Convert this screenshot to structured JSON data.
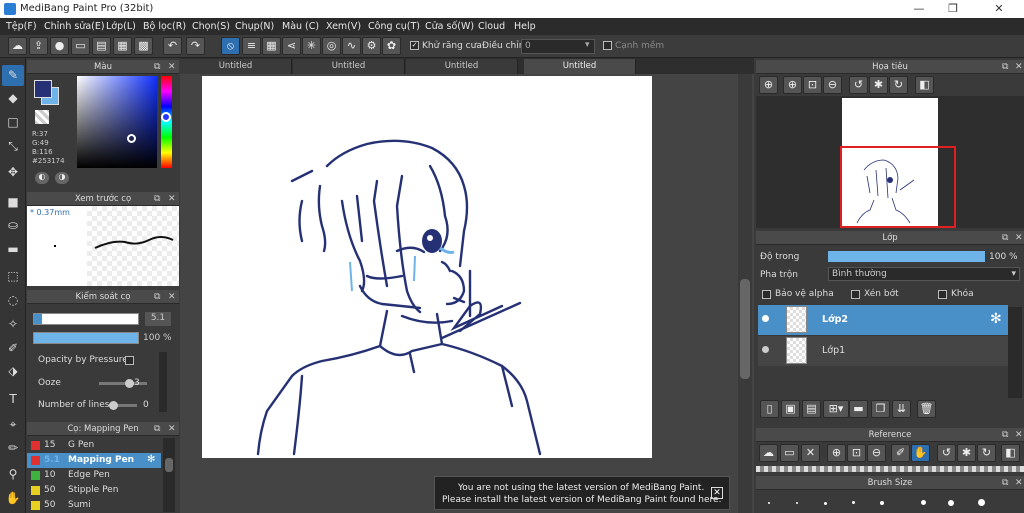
{
  "window": {
    "title": "MediBang Paint Pro (32bit)",
    "minimize": "—",
    "restore": "❐",
    "close": "✕"
  },
  "menu": [
    "Tệp(F)",
    "Chỉnh sửa(E)",
    "Lớp(L)",
    "Bộ lọc(R)",
    "Chọn(S)",
    "Chụp(N)",
    "Màu (C)",
    "Xem(V)",
    "Công cụ(T)",
    "Cửa số(W)",
    "Cloud",
    "Help"
  ],
  "toolbar": {
    "antialias_label": "Khử răng cưa",
    "adjust_label": "Điều chỉnh",
    "zoom_value": "0",
    "edge_label": "Cạnh mềm"
  },
  "color_panel": {
    "title": "Màu",
    "r": "R:37",
    "g": "G:49",
    "b": "B:116",
    "hex": "#253174",
    "main_color": "#253174",
    "secondary_color": "#6fb4e8"
  },
  "brush_preview": {
    "title": "Xem trước cọ",
    "size": "0.37mm"
  },
  "brush_control": {
    "title": "Kiểm soát cọ",
    "size_value": "5.1",
    "opacity_value": "100 %",
    "opacity_pressure_label": "Opacity by Pressure",
    "ooze_label": "Ooze",
    "ooze_value": "3",
    "lines_label": "Number of lines",
    "lines_value": "0"
  },
  "brush_list": {
    "title": "Cọ: Mapping Pen",
    "items": [
      {
        "size": "15",
        "name": "G Pen",
        "color": "#e03030"
      },
      {
        "size": "5.1",
        "name": "Mapping Pen",
        "color": "#e03030"
      },
      {
        "size": "10",
        "name": "Edge Pen",
        "color": "#40b040"
      },
      {
        "size": "50",
        "name": "Stipple Pen",
        "color": "#e8d020"
      },
      {
        "size": "50",
        "name": "Sumi",
        "color": "#e8d020"
      }
    ]
  },
  "tabs": [
    "Untitled",
    "Untitled",
    "Untitled",
    "Untitled"
  ],
  "notice": {
    "line1": "You are not using the latest version of MediBang Paint.",
    "line2": "Please install the latest version of MediBang Paint found here."
  },
  "navigator": {
    "title": "Họa tiêu"
  },
  "layer_panel": {
    "title": "Lớp",
    "opacity_label": "Độ trong",
    "opacity_value": "100 %",
    "blend_label": "Pha trộn",
    "blend_value": "Bình thường",
    "protect_alpha": "Bảo vệ alpha",
    "clipping": "Xén bớt",
    "lock": "Khóa",
    "layers": [
      {
        "name": "Lớp2",
        "selected": true
      },
      {
        "name": "Lớp1",
        "selected": false
      }
    ]
  },
  "reference": {
    "title": "Reference"
  },
  "brush_size": {
    "title": "Brush Size"
  },
  "colors": {
    "accent": "#2e6fb0",
    "selection": "#4a90c8",
    "line": "#253174",
    "tear": "#6fb4e8"
  }
}
